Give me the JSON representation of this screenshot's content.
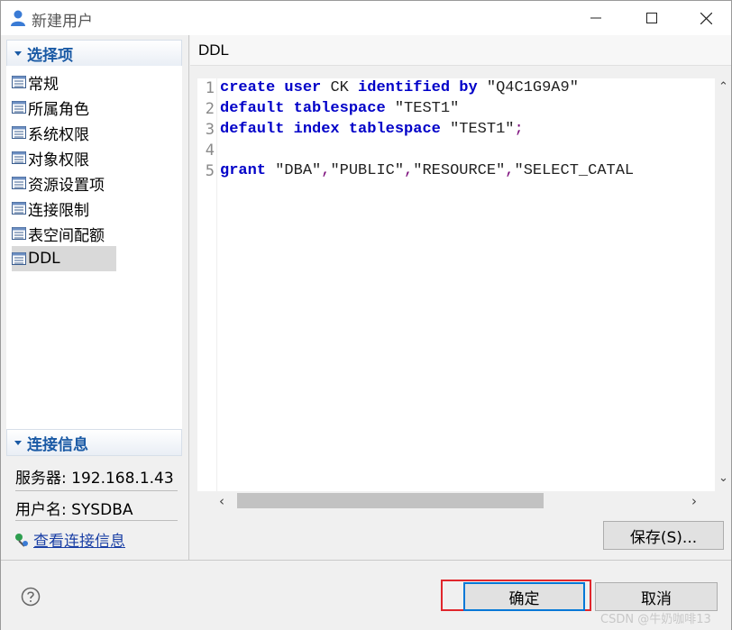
{
  "window": {
    "title": "新建用户"
  },
  "left": {
    "section1_title": "选择项",
    "nav_items": [
      "常规",
      "所属角色",
      "系统权限",
      "对象权限",
      "资源设置项",
      "连接限制",
      "表空间配额",
      "DDL"
    ],
    "selected_item": "DDL",
    "section2_title": "连接信息",
    "server": "服务器: 192.168.1.43",
    "user": "用户名: SYSDBA",
    "view_link": "查看连接信息"
  },
  "right": {
    "header": "DDL",
    "line_numbers": [
      "1",
      "2",
      "3",
      "4",
      "5"
    ],
    "code": {
      "l1_kw1": "create",
      "l1_kw2": "user",
      "l1_name": "CK",
      "l1_kw3": "identified",
      "l1_kw4": "by",
      "l1_str": "\"Q4C1G9A9\"",
      "l2_kw1": "default",
      "l2_kw2": "tablespace",
      "l2_str": "\"TEST1\"",
      "l3_kw1": "default",
      "l3_kw2": "index",
      "l3_kw3": "tablespace",
      "l3_str": "\"TEST1\"",
      "l3_punc": ";",
      "l5_kw1": "grant",
      "l5_str1": "\"DBA\"",
      "l5_str2": "\"PUBLIC\"",
      "l5_str3": "\"RESOURCE\"",
      "l5_str4": "\"SELECT_CATAL",
      "comma": ","
    },
    "save_button": "保存(S)..."
  },
  "footer": {
    "ok_button": "确定",
    "cancel_button": "取消",
    "watermark": "CSDN @牛奶咖啡13"
  },
  "icons": {
    "title": "user-icon",
    "min": "minimize-icon",
    "max": "maximize-icon",
    "close": "close-icon",
    "nav": "list-page-icon",
    "connection": "connection-icon",
    "help": "help-icon"
  },
  "colors": {
    "keyword": "#0000c8",
    "section_title": "#1a5aa5",
    "focus_border": "#e0262c"
  }
}
